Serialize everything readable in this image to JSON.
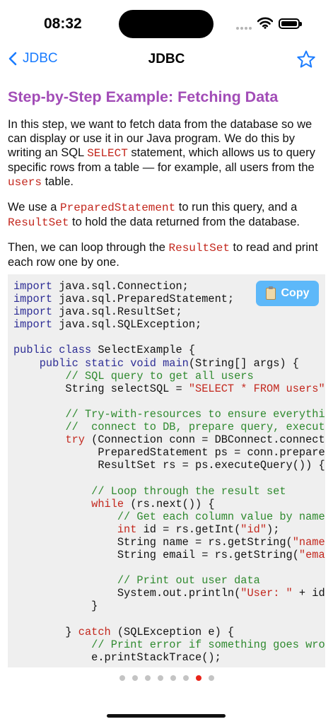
{
  "status": {
    "time": "08:32"
  },
  "nav": {
    "back_label": "JDBC",
    "title": "JDBC"
  },
  "heading": "Step-by-Step Example: Fetching Data",
  "paragraphs": {
    "p1": {
      "t1": "In this step, we want to fetch data from the database so we can display or use it in our Java program. We do this by writing an SQL ",
      "k1": "SELECT",
      "t2": " statement, which allows us to query specific rows from a table — for example, all users from the ",
      "k2": "users",
      "t3": " table."
    },
    "p2": {
      "t1": "We use a ",
      "k1": "PreparedStatement",
      "t2": " to run this query, and a ",
      "k2": "ResultSet",
      "t3": " to hold the data returned from the database."
    },
    "p3": {
      "t1": "Then, we can loop through the ",
      "k1": "ResultSet",
      "t2": " to read and print each row one by one."
    }
  },
  "code": {
    "copy_label": "Copy",
    "lines": {
      "l1a": "import",
      "l1b": " java.sql.Connection;",
      "l2a": "import",
      "l2b": " java.sql.PreparedStatement;",
      "l3a": "import",
      "l3b": " java.sql.ResultSet;",
      "l4a": "import",
      "l4b": " java.sql.SQLException;",
      "l6a": "public class",
      "l6b": " SelectExample {",
      "l7i": "    ",
      "l7a": "public static void",
      "l7b": " main",
      "l7c": "(String[] args) {",
      "l8i": "        ",
      "l8c": "// SQL query to get all users",
      "l9a": "        String selectSQL = ",
      "l9s": "\"SELECT * FROM users\"",
      "l9b": ";",
      "l11i": "        ",
      "l11c": "// Try-with-resources to ensure everythin",
      "l12i": "        ",
      "l12c": "//  connect to DB, prepare query, execute",
      "l13i": "        ",
      "l13k": "try",
      "l13b": " (Connection conn = DBConnect.connect(",
      "l14": "             PreparedStatement ps = conn.prepareS",
      "l15": "             ResultSet rs = ps.executeQuery()) {",
      "l17i": "            ",
      "l17c": "// Loop through the result set",
      "l18i": "            ",
      "l18k": "while",
      "l18b": " (rs.next()) {",
      "l19i": "                ",
      "l19c": "// Get each column value by name",
      "l20i": "                ",
      "l20k": "int",
      "l20b": " id = rs.getInt(",
      "l20s": "\"id\"",
      "l20e": ");",
      "l21a": "                String name = rs.getString(",
      "l21s": "\"name\"",
      "l22a": "                String email = rs.getString(",
      "l22s": "\"emai",
      "l24i": "                ",
      "l24c": "// Print out user data",
      "l25a": "                System.out.println(",
      "l25s": "\"User: \"",
      "l25b": " + id",
      "l26": "            }",
      "l28i": "        } ",
      "l28k": "catch",
      "l28b": " (SQLException e) {",
      "l29i": "            ",
      "l29c": "// Print error if something goes wron",
      "l30": "            e.printStackTrace();"
    }
  },
  "pagination": {
    "total": 8,
    "active_index": 6
  },
  "colors": {
    "accent": "#1a7cff",
    "heading": "#a24cb7",
    "keyword": "#c3271d",
    "comment": "#2f8a2f",
    "copy_button": "#5db8f9",
    "active_dot": "#e8241a"
  }
}
